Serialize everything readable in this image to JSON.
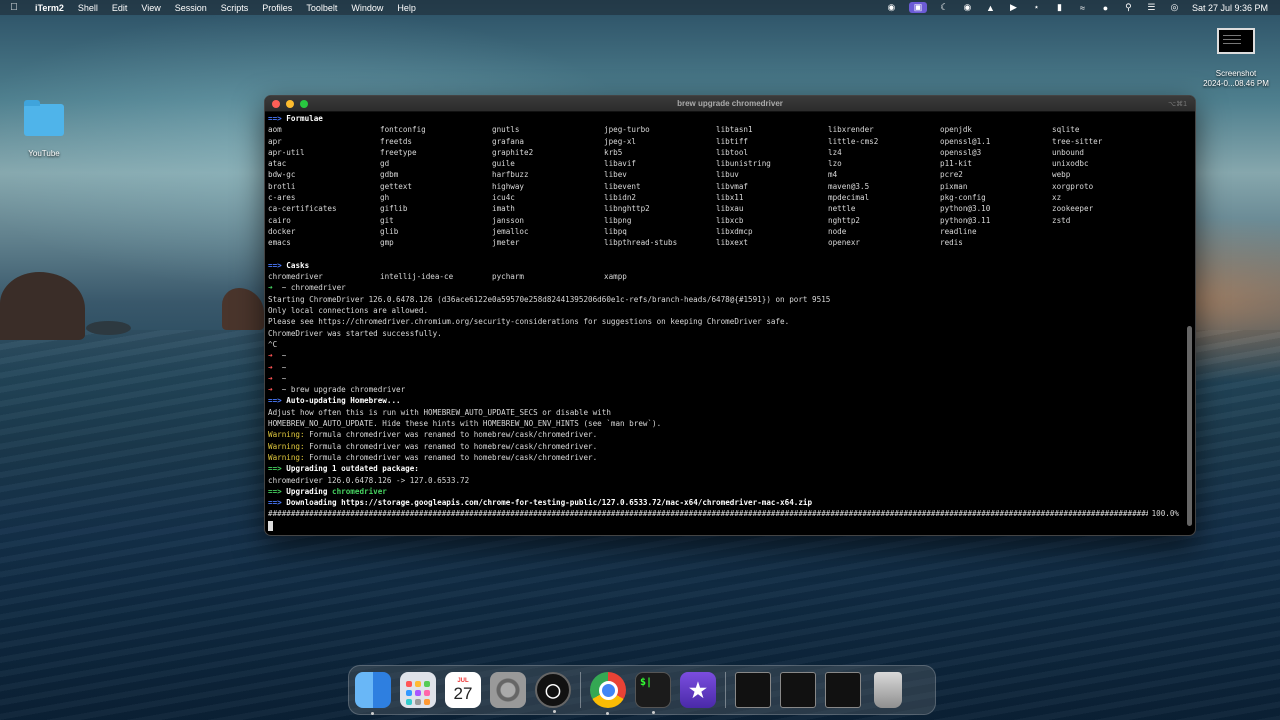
{
  "menubar": {
    "app_name": "iTerm2",
    "items": [
      "Shell",
      "Edit",
      "View",
      "Session",
      "Scripts",
      "Profiles",
      "Toolbelt",
      "Window",
      "Help"
    ],
    "clock": "Sat 27 Jul  9:36 PM"
  },
  "desktop": {
    "folder_label": "YouTube",
    "screenshot_label_line1": "Screenshot",
    "screenshot_label_line2": "2024-0...08.46 PM"
  },
  "terminal": {
    "title": "brew upgrade chromedriver",
    "shortcut": "⌥⌘1",
    "formulae_header": "Formulae",
    "formulae": [
      "aom",
      "fontconfig",
      "gnutls",
      "jpeg-turbo",
      "libtasn1",
      "libxrender",
      "openjdk",
      "sqlite",
      "apr",
      "freetds",
      "grafana",
      "jpeg-xl",
      "libtiff",
      "little-cms2",
      "openssl@1.1",
      "tree-sitter",
      "apr-util",
      "freetype",
      "graphite2",
      "krb5",
      "libtool",
      "lz4",
      "openssl@3",
      "unbound",
      "atac",
      "gd",
      "guile",
      "libavif",
      "libunistring",
      "lzo",
      "p11-kit",
      "unixodbc",
      "bdw-gc",
      "gdbm",
      "harfbuzz",
      "libev",
      "libuv",
      "m4",
      "pcre2",
      "webp",
      "brotli",
      "gettext",
      "highway",
      "libevent",
      "libvmaf",
      "maven@3.5",
      "pixman",
      "xorgproto",
      "c-ares",
      "gh",
      "icu4c",
      "libidn2",
      "libx11",
      "mpdecimal",
      "pkg-config",
      "xz",
      "ca-certificates",
      "giflib",
      "imath",
      "libnghttp2",
      "libxau",
      "nettle",
      "python@3.10",
      "zookeeper",
      "cairo",
      "git",
      "jansson",
      "libpng",
      "libxcb",
      "nghttp2",
      "python@3.11",
      "zstd",
      "docker",
      "glib",
      "jemalloc",
      "libpq",
      "libxdmcp",
      "node",
      "readline",
      "",
      "emacs",
      "gmp",
      "jmeter",
      "libpthread-stubs",
      "libxext",
      "openexr",
      "redis",
      ""
    ],
    "casks_header": "Casks",
    "casks": [
      "chromedriver",
      "intellij-idea-ce",
      "pycharm",
      "xampp"
    ],
    "prompt_cmd1": "~ chromedriver",
    "lines_a": [
      "Starting ChromeDriver 126.0.6478.126 (d36ace6122e0a59570e258d82441395206d60e1c-refs/branch-heads/6478@{#1591}) on port 9515",
      "Only local connections are allowed.",
      "Please see https://chromedriver.chromium.org/security-considerations for suggestions on keeping ChromeDriver safe.",
      "ChromeDriver was started successfully.",
      "^C"
    ],
    "tilde": "~",
    "prompt_cmd2": "~ brew upgrade chromedriver",
    "auto_updating": "Auto-updating Homebrew...",
    "adjust_line1": "Adjust how often this is run with HOMEBREW_AUTO_UPDATE_SECS or disable with",
    "adjust_line2": "HOMEBREW_NO_AUTO_UPDATE. Hide these hints with HOMEBREW_NO_ENV_HINTS (see `man brew`).",
    "warning_label": "Warning:",
    "warning_text": " Formula chromedriver was renamed to homebrew/cask/chromedriver.",
    "upgrading_outdated": "Upgrading 1 outdated package:",
    "version_line": "chromedriver 126.0.6478.126 -> 127.0.6533.72",
    "upgrading_label": "Upgrading ",
    "upgrading_pkg": "chromedriver",
    "downloading": "Downloading https://storage.googleapis.com/chrome-for-testing-public/127.0.6533.72/mac-x64/chromedriver-mac-x64.zip",
    "progress_percent": "100.0%",
    "progress_value": 1.0
  },
  "dock": {
    "calendar_month": "JUL",
    "calendar_day": "27",
    "terminal_glyph": "$|",
    "apps": [
      "finder-icon",
      "launchpad-icon",
      "calendar-icon",
      "system-settings-icon",
      "obs-icon",
      "chrome-icon",
      "terminal-icon",
      "imovie-icon",
      "trash-icon"
    ]
  },
  "colors": {
    "arrow_blue": "#4a7bff",
    "warning_yellow": "#e4cc3e",
    "success_green": "#46d160",
    "prompt_red": "#ff5555"
  }
}
